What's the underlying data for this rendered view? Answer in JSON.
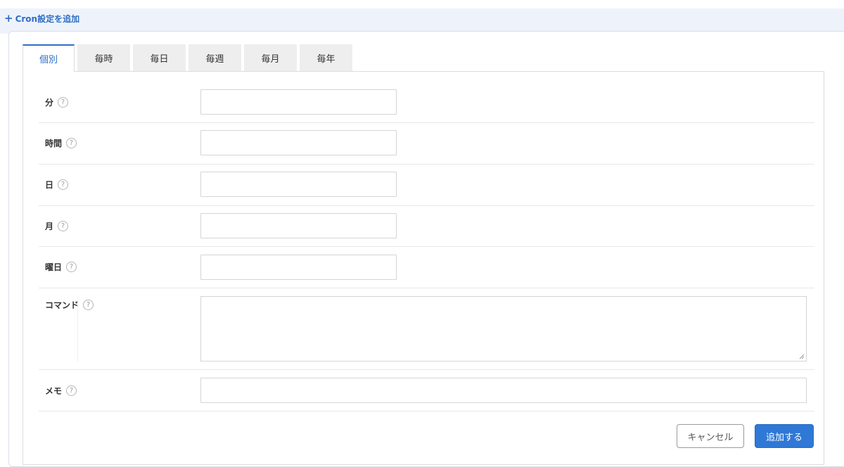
{
  "header": {
    "add_label": "Cron設定を追加",
    "plus": "+"
  },
  "tabs": [
    {
      "label": "個別"
    },
    {
      "label": "毎時"
    },
    {
      "label": "毎日"
    },
    {
      "label": "毎週"
    },
    {
      "label": "毎月"
    },
    {
      "label": "毎年"
    }
  ],
  "form": {
    "minute": {
      "label": "分",
      "value": ""
    },
    "hour": {
      "label": "時間",
      "value": ""
    },
    "day": {
      "label": "日",
      "value": ""
    },
    "month": {
      "label": "月",
      "value": ""
    },
    "weekday": {
      "label": "曜日",
      "value": ""
    },
    "command": {
      "label": "コマンド",
      "value": ""
    },
    "memo": {
      "label": "メモ",
      "value": ""
    },
    "help_glyph": "?"
  },
  "buttons": {
    "cancel": "キャンセル",
    "add": "追加する"
  },
  "colors": {
    "accent": "#2f78d6",
    "link": "#2f6fc4",
    "header_bg": "#eef3fb"
  }
}
